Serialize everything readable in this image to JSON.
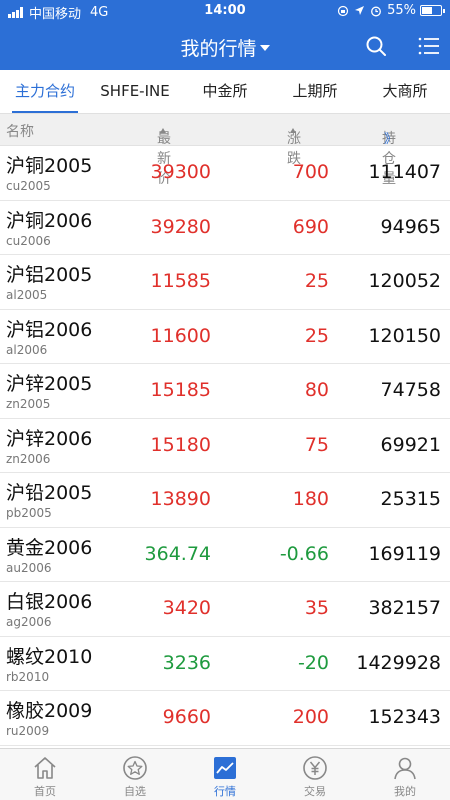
{
  "status": {
    "carrier": "中国移动",
    "network": "4G",
    "time": "14:00",
    "battery": "55%",
    "battery_level": 0.55
  },
  "nav": {
    "title": "我的行情"
  },
  "tabs": [
    {
      "label": "主力合约",
      "active": true
    },
    {
      "label": "SHFE-INE",
      "active": false
    },
    {
      "label": "中金所",
      "active": false
    },
    {
      "label": "上期所",
      "active": false
    },
    {
      "label": "大商所",
      "active": false
    }
  ],
  "columns": {
    "name": "名称",
    "price": "最新价",
    "change": "涨跌",
    "oi": "持仓量",
    "more": "》"
  },
  "rows": [
    {
      "name": "沪铜2005",
      "code": "cu2005",
      "price": "39300",
      "change": "700",
      "oi": "111407",
      "dir": "up"
    },
    {
      "name": "沪铜2006",
      "code": "cu2006",
      "price": "39280",
      "change": "690",
      "oi": "94965",
      "dir": "up"
    },
    {
      "name": "沪铝2005",
      "code": "al2005",
      "price": "11585",
      "change": "25",
      "oi": "120052",
      "dir": "up"
    },
    {
      "name": "沪铝2006",
      "code": "al2006",
      "price": "11600",
      "change": "25",
      "oi": "120150",
      "dir": "up"
    },
    {
      "name": "沪锌2005",
      "code": "zn2005",
      "price": "15185",
      "change": "80",
      "oi": "74758",
      "dir": "up"
    },
    {
      "name": "沪锌2006",
      "code": "zn2006",
      "price": "15180",
      "change": "75",
      "oi": "69921",
      "dir": "up"
    },
    {
      "name": "沪铅2005",
      "code": "pb2005",
      "price": "13890",
      "change": "180",
      "oi": "25315",
      "dir": "up"
    },
    {
      "name": "黄金2006",
      "code": "au2006",
      "price": "364.74",
      "change": "-0.66",
      "oi": "169119",
      "dir": "down"
    },
    {
      "name": "白银2006",
      "code": "ag2006",
      "price": "3420",
      "change": "35",
      "oi": "382157",
      "dir": "up"
    },
    {
      "name": "螺纹2010",
      "code": "rb2010",
      "price": "3236",
      "change": "-20",
      "oi": "1429928",
      "dir": "down"
    },
    {
      "name": "橡胶2009",
      "code": "ru2009",
      "price": "9660",
      "change": "200",
      "oi": "152343",
      "dir": "up"
    }
  ],
  "colors": {
    "brand": "#2c6fd6",
    "up": "#e0302b",
    "down": "#1e9a3e"
  },
  "tabbar": [
    {
      "label": "首页",
      "icon": "home-icon",
      "active": false
    },
    {
      "label": "自选",
      "icon": "star-circle-icon",
      "active": false
    },
    {
      "label": "行情",
      "icon": "chart-icon",
      "active": true
    },
    {
      "label": "交易",
      "icon": "yen-icon",
      "active": false
    },
    {
      "label": "我的",
      "icon": "person-icon",
      "active": false
    }
  ]
}
